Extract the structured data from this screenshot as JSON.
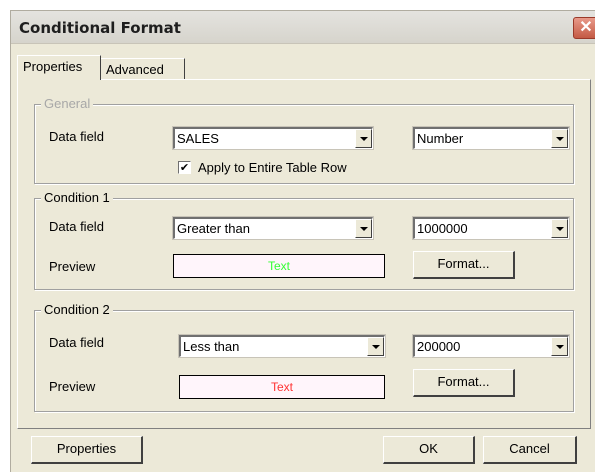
{
  "window": {
    "title": "Conditional Format",
    "close_glyph": "✕"
  },
  "tabs": [
    {
      "label": "Properties",
      "active": true
    },
    {
      "label": "Advanced",
      "active": false
    }
  ],
  "general": {
    "legend": "General",
    "data_field_label": "Data field",
    "data_field_value": "SALES",
    "type_value": "Number",
    "apply_row_checked": true,
    "apply_row_mark": "✔",
    "apply_row_label": "Apply to Entire Table Row"
  },
  "condition1": {
    "legend": "Condition 1",
    "data_field_label": "Data field",
    "operator": "Greater than",
    "value": "1000000",
    "preview_label": "Preview",
    "preview_text": "Text",
    "preview_color": "#33ff33",
    "format_button": "Format..."
  },
  "condition2": {
    "legend": "Condition 2",
    "data_field_label": "Data field",
    "operator": "Less than",
    "value": "200000",
    "preview_label": "Preview",
    "preview_text": "Text",
    "preview_color": "#ff3333",
    "format_button": "Format..."
  },
  "footer": {
    "properties_button": "Properties",
    "ok_button": "OK",
    "cancel_button": "Cancel"
  }
}
